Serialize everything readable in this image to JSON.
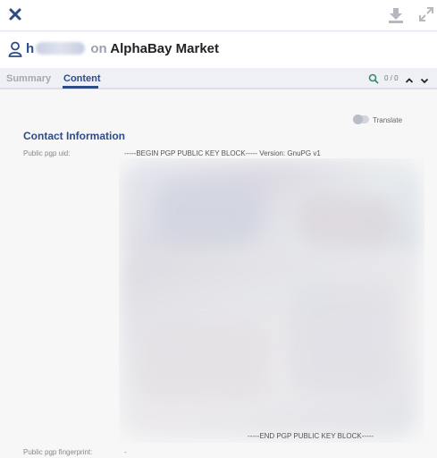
{
  "header": {
    "user_initial": "h",
    "connector": "on",
    "market": "AlphaBay Market"
  },
  "tabs": [
    {
      "label": "Summary"
    },
    {
      "label": "Content"
    }
  ],
  "search": {
    "match_count": "0 / 0"
  },
  "translate": {
    "label": "Translate"
  },
  "content": {
    "section_title": "Contact Information",
    "fields": [
      {
        "label": "Public pgp uid:",
        "begin_text": "-----BEGIN PGP PUBLIC KEY BLOCK----- Version: GnuPG v1",
        "end_text": "-----END PGP PUBLIC KEY BLOCK-----"
      },
      {
        "label": "Public pgp fingerprint:",
        "value": "-"
      }
    ]
  },
  "colors": {
    "accent": "#2d4b86",
    "muted_tab": "#a3a8b4"
  }
}
